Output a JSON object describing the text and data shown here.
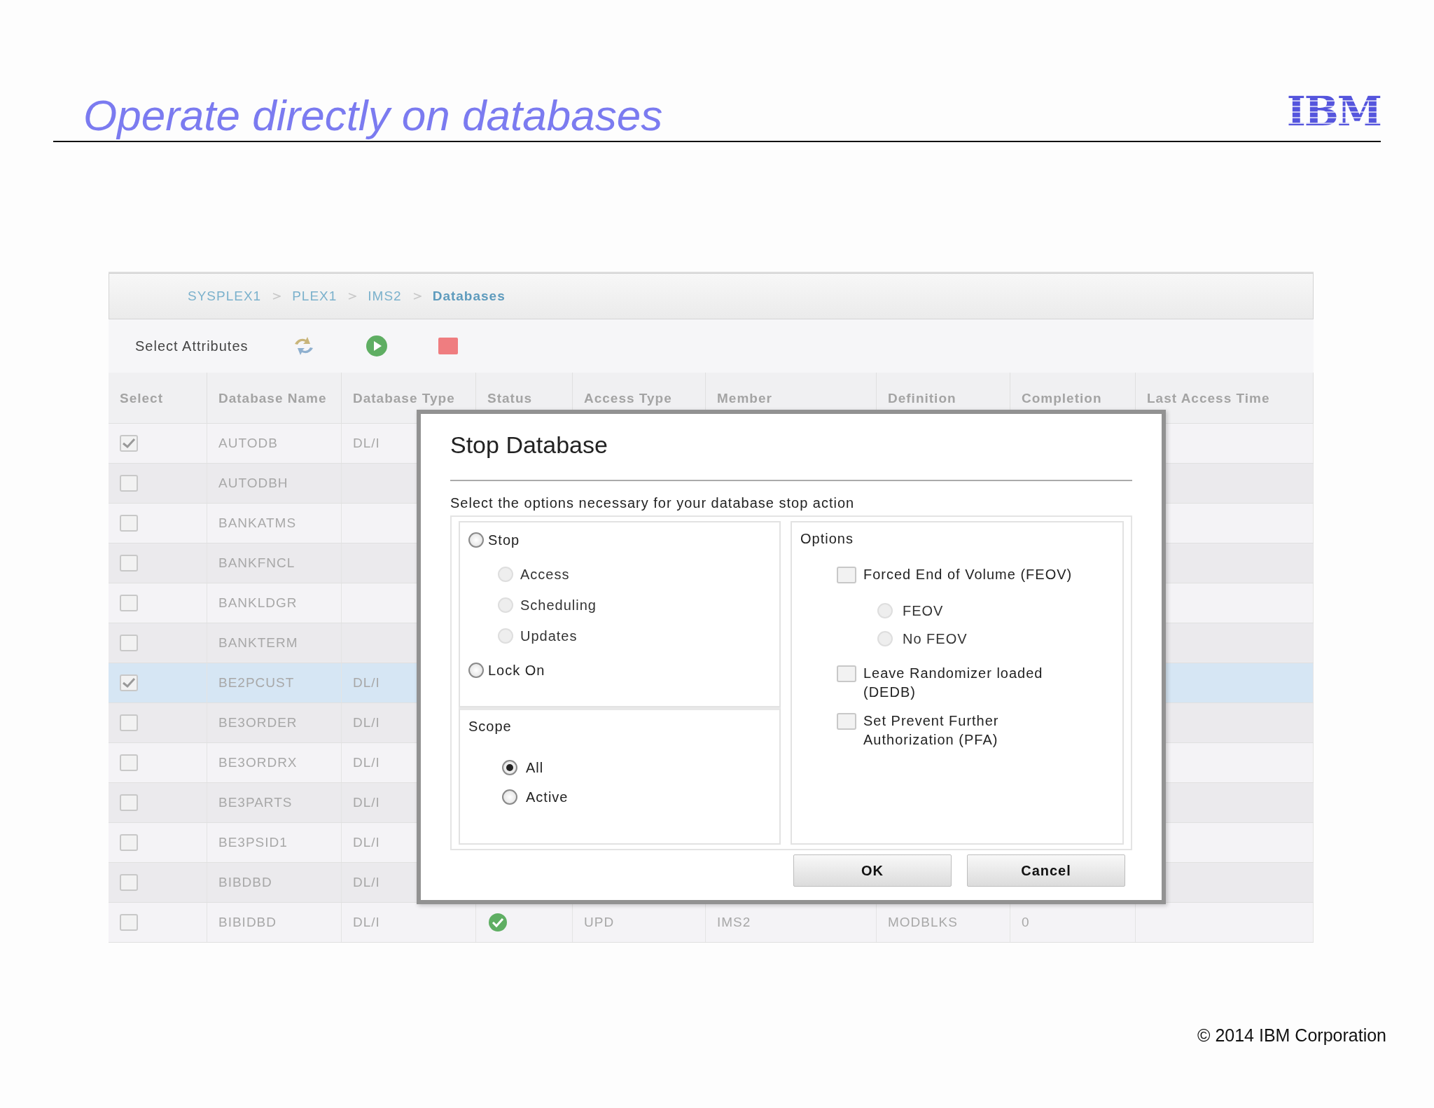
{
  "slide": {
    "title": "Operate directly on databases",
    "logo": "IBM",
    "footer": "© 2014 IBM Corporation"
  },
  "breadcrumbs": [
    {
      "label": "SYSPLEX1",
      "current": false
    },
    {
      "label": "PLEX1",
      "current": false
    },
    {
      "label": "IMS2",
      "current": false
    },
    {
      "label": "Databases",
      "current": true
    }
  ],
  "toolbar": {
    "label": "Select Attributes"
  },
  "table": {
    "columns": [
      "Select",
      "Database Name",
      "Database Type",
      "Status",
      "Access Type",
      "Member",
      "Definition",
      "Completion",
      "Last Access Time"
    ],
    "rows": [
      {
        "checked": true,
        "selected": false,
        "name": "AUTODB",
        "type": "DL/I"
      },
      {
        "checked": false,
        "selected": false,
        "name": "AUTODBH"
      },
      {
        "checked": false,
        "selected": false,
        "name": "BANKATMS"
      },
      {
        "checked": false,
        "selected": false,
        "name": "BANKFNCL"
      },
      {
        "checked": false,
        "selected": false,
        "name": "BANKLDGR"
      },
      {
        "checked": false,
        "selected": false,
        "name": "BANKTERM"
      },
      {
        "checked": true,
        "selected": true,
        "name": "BE2PCUST",
        "type": "DL/I"
      },
      {
        "checked": false,
        "selected": false,
        "name": "BE3ORDER",
        "type": "DL/I"
      },
      {
        "checked": false,
        "selected": false,
        "name": "BE3ORDRX",
        "type": "DL/I"
      },
      {
        "checked": false,
        "selected": false,
        "name": "BE3PARTS",
        "type": "DL/I"
      },
      {
        "checked": false,
        "selected": false,
        "name": "BE3PSID1",
        "type": "DL/I"
      },
      {
        "checked": false,
        "selected": false,
        "name": "BIBDBD",
        "type": "DL/I"
      },
      {
        "checked": false,
        "selected": false,
        "name": "BIBIDBD",
        "type": "DL/I",
        "status_ok": true,
        "access_type": "UPD",
        "member": "IMS2",
        "definition_type": "MODBLKS",
        "completion_code": "0"
      }
    ]
  },
  "dialog": {
    "title": "Stop Database",
    "instruction": "Select the options necessary for your database stop action",
    "actions": [
      {
        "label": "Stop",
        "selected": false,
        "disabled": false,
        "children": [
          {
            "label": "Access",
            "selected": false,
            "disabled": true
          },
          {
            "label": "Scheduling",
            "selected": false,
            "disabled": true
          },
          {
            "label": "Updates",
            "selected": false,
            "disabled": true
          }
        ]
      },
      {
        "label": "Lock On",
        "selected": false,
        "disabled": false
      }
    ],
    "scope": {
      "title": "Scope",
      "options": [
        {
          "label": "All",
          "selected": true
        },
        {
          "label": "Active",
          "selected": false
        }
      ]
    },
    "options": {
      "title": "Options",
      "items": [
        {
          "label": "Forced End of Volume (FEOV)",
          "checked": false,
          "children": [
            {
              "label": "FEOV",
              "selected": false,
              "disabled": true
            },
            {
              "label": "No FEOV",
              "selected": false,
              "disabled": true
            }
          ]
        },
        {
          "label": "Leave Randomizer loaded (DEDB)",
          "checked": false
        },
        {
          "label": "Set Prevent Further Authorization (PFA)",
          "checked": false
        }
      ]
    },
    "buttons": [
      "OK",
      "Cancel"
    ]
  }
}
